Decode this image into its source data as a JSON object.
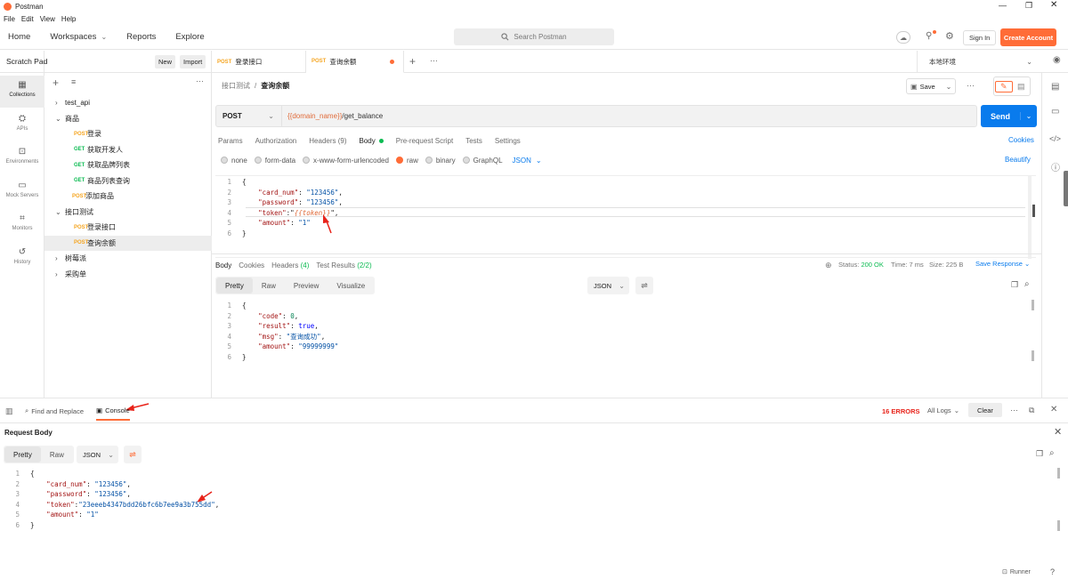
{
  "window": {
    "title": "Postman",
    "menu": [
      "File",
      "Edit",
      "View",
      "Help"
    ]
  },
  "header": {
    "nav": [
      "Home",
      "Workspaces",
      "Reports",
      "Explore"
    ],
    "search_placeholder": "Search Postman",
    "sign_in": "Sign In",
    "create_account": "Create Account"
  },
  "sidebar": {
    "title": "Scratch Pad",
    "new_label": "New",
    "import_label": "Import",
    "rail": [
      "Collections",
      "APIs",
      "Environments",
      "Mock Servers",
      "Monitors",
      "History"
    ],
    "tree": [
      {
        "type": "folder",
        "label": "test_api",
        "indent": 0,
        "open": false
      },
      {
        "type": "folder",
        "label": "商品",
        "indent": 0,
        "open": true
      },
      {
        "type": "req",
        "method": "POST",
        "label": "登录",
        "indent": 2
      },
      {
        "type": "req",
        "method": "GET",
        "label": "获取开发人",
        "indent": 2
      },
      {
        "type": "req",
        "method": "GET",
        "label": "获取品牌列表",
        "indent": 2
      },
      {
        "type": "req",
        "method": "GET",
        "label": "商品列表查询",
        "indent": 2
      },
      {
        "type": "req",
        "method": "POST",
        "label": "添加商品",
        "indent": 1
      },
      {
        "type": "folder",
        "label": "接口测试",
        "indent": 0,
        "open": true
      },
      {
        "type": "req",
        "method": "POST",
        "label": "登录接口",
        "indent": 2
      },
      {
        "type": "req",
        "method": "POST",
        "label": "查询余额",
        "indent": 2,
        "selected": true
      },
      {
        "type": "folder",
        "label": "树莓派",
        "indent": 0,
        "open": false
      },
      {
        "type": "folder",
        "label": "采购单",
        "indent": 0,
        "open": false
      }
    ]
  },
  "tabs": [
    {
      "method": "POST",
      "label": "登录接口"
    },
    {
      "method": "POST",
      "label": "查询余额",
      "active": true
    }
  ],
  "environment": "本地环境",
  "request": {
    "breadcrumb_parent": "接口测试",
    "breadcrumb_sep": "/",
    "breadcrumb_current": "查询余额",
    "save_label": "Save",
    "method": "POST",
    "url_var": "{{domain_name}}",
    "url_path": "/get_balance",
    "send_label": "Send",
    "tabs": [
      "Params",
      "Authorization",
      "Headers (9)",
      "Body",
      "Pre-request Script",
      "Tests",
      "Settings"
    ],
    "cookies_label": "Cookies",
    "body_modes": [
      "none",
      "form-data",
      "x-www-form-urlencoded",
      "raw",
      "binary",
      "GraphQL"
    ],
    "body_format": "JSON",
    "beautify_label": "Beautify",
    "body_lines": [
      [
        {
          "t": "p",
          "v": "{"
        }
      ],
      [
        {
          "t": "p",
          "v": "    "
        },
        {
          "t": "key",
          "v": "\"card_num\""
        },
        {
          "t": "p",
          "v": ": "
        },
        {
          "t": "str",
          "v": "\"123456\""
        },
        {
          "t": "p",
          "v": ","
        }
      ],
      [
        {
          "t": "p",
          "v": "    "
        },
        {
          "t": "key",
          "v": "\"password\""
        },
        {
          "t": "p",
          "v": ": "
        },
        {
          "t": "str",
          "v": "\"123456\""
        },
        {
          "t": "p",
          "v": ","
        }
      ],
      [
        {
          "t": "p",
          "v": "    "
        },
        {
          "t": "key",
          "v": "\"token\""
        },
        {
          "t": "p",
          "v": ":\""
        },
        {
          "t": "var",
          "v": "{{token}}"
        },
        {
          "t": "p",
          "v": "\","
        }
      ],
      [
        {
          "t": "p",
          "v": "    "
        },
        {
          "t": "key",
          "v": "\"amount\""
        },
        {
          "t": "p",
          "v": ": "
        },
        {
          "t": "str",
          "v": "\"1\""
        }
      ],
      [
        {
          "t": "p",
          "v": "}"
        }
      ]
    ]
  },
  "response": {
    "tabs": [
      "Body",
      "Cookies",
      "Headers (4)",
      "Test Results (2/2)"
    ],
    "status": "Status: 200 OK",
    "time": "Time: 7 ms",
    "size": "Size: 225 B",
    "save_response": "Save Response",
    "views": [
      "Pretty",
      "Raw",
      "Preview",
      "Visualize"
    ],
    "format": "JSON",
    "lines": [
      [
        {
          "t": "p",
          "v": "{"
        }
      ],
      [
        {
          "t": "p",
          "v": "    "
        },
        {
          "t": "key",
          "v": "\"code\""
        },
        {
          "t": "p",
          "v": ": "
        },
        {
          "t": "num",
          "v": "0"
        },
        {
          "t": "p",
          "v": ","
        }
      ],
      [
        {
          "t": "p",
          "v": "    "
        },
        {
          "t": "key",
          "v": "\"result\""
        },
        {
          "t": "p",
          "v": ": "
        },
        {
          "t": "kw",
          "v": "true"
        },
        {
          "t": "p",
          "v": ","
        }
      ],
      [
        {
          "t": "p",
          "v": "    "
        },
        {
          "t": "key",
          "v": "\"msg\""
        },
        {
          "t": "p",
          "v": ": "
        },
        {
          "t": "str",
          "v": "\"查询成功\""
        },
        {
          "t": "p",
          "v": ","
        }
      ],
      [
        {
          "t": "p",
          "v": "    "
        },
        {
          "t": "key",
          "v": "\"amount\""
        },
        {
          "t": "p",
          "v": ": "
        },
        {
          "t": "str",
          "v": "\"99999999\""
        }
      ],
      [
        {
          "t": "p",
          "v": "}"
        }
      ]
    ]
  },
  "console": {
    "find_replace": "Find and Replace",
    "console_label": "Console",
    "errors": "16 ERRORS",
    "all_logs": "All Logs",
    "clear_label": "Clear",
    "section_title": "Request Body",
    "views": [
      "Pretty",
      "Raw"
    ],
    "format": "JSON",
    "lines": [
      [
        {
          "t": "p",
          "v": "{"
        }
      ],
      [
        {
          "t": "p",
          "v": "    "
        },
        {
          "t": "key",
          "v": "\"card_num\""
        },
        {
          "t": "p",
          "v": ": "
        },
        {
          "t": "str",
          "v": "\"123456\""
        },
        {
          "t": "p",
          "v": ","
        }
      ],
      [
        {
          "t": "p",
          "v": "    "
        },
        {
          "t": "key",
          "v": "\"password\""
        },
        {
          "t": "p",
          "v": ": "
        },
        {
          "t": "str",
          "v": "\"123456\""
        },
        {
          "t": "p",
          "v": ","
        }
      ],
      [
        {
          "t": "p",
          "v": "    "
        },
        {
          "t": "key",
          "v": "\"token\""
        },
        {
          "t": "p",
          "v": ":"
        },
        {
          "t": "str",
          "v": "\"23eeeb4347bdd26bfc6b7ee9a3b755dd\""
        },
        {
          "t": "p",
          "v": ","
        }
      ],
      [
        {
          "t": "p",
          "v": "    "
        },
        {
          "t": "key",
          "v": "\"amount\""
        },
        {
          "t": "p",
          "v": ": "
        },
        {
          "t": "str",
          "v": "\"1\""
        }
      ],
      [
        {
          "t": "p",
          "v": "}"
        }
      ]
    ],
    "runner": "Runner"
  },
  "colors": {
    "accent": "#ff6c37",
    "send": "#097bed",
    "annotation": "#e8231a"
  }
}
